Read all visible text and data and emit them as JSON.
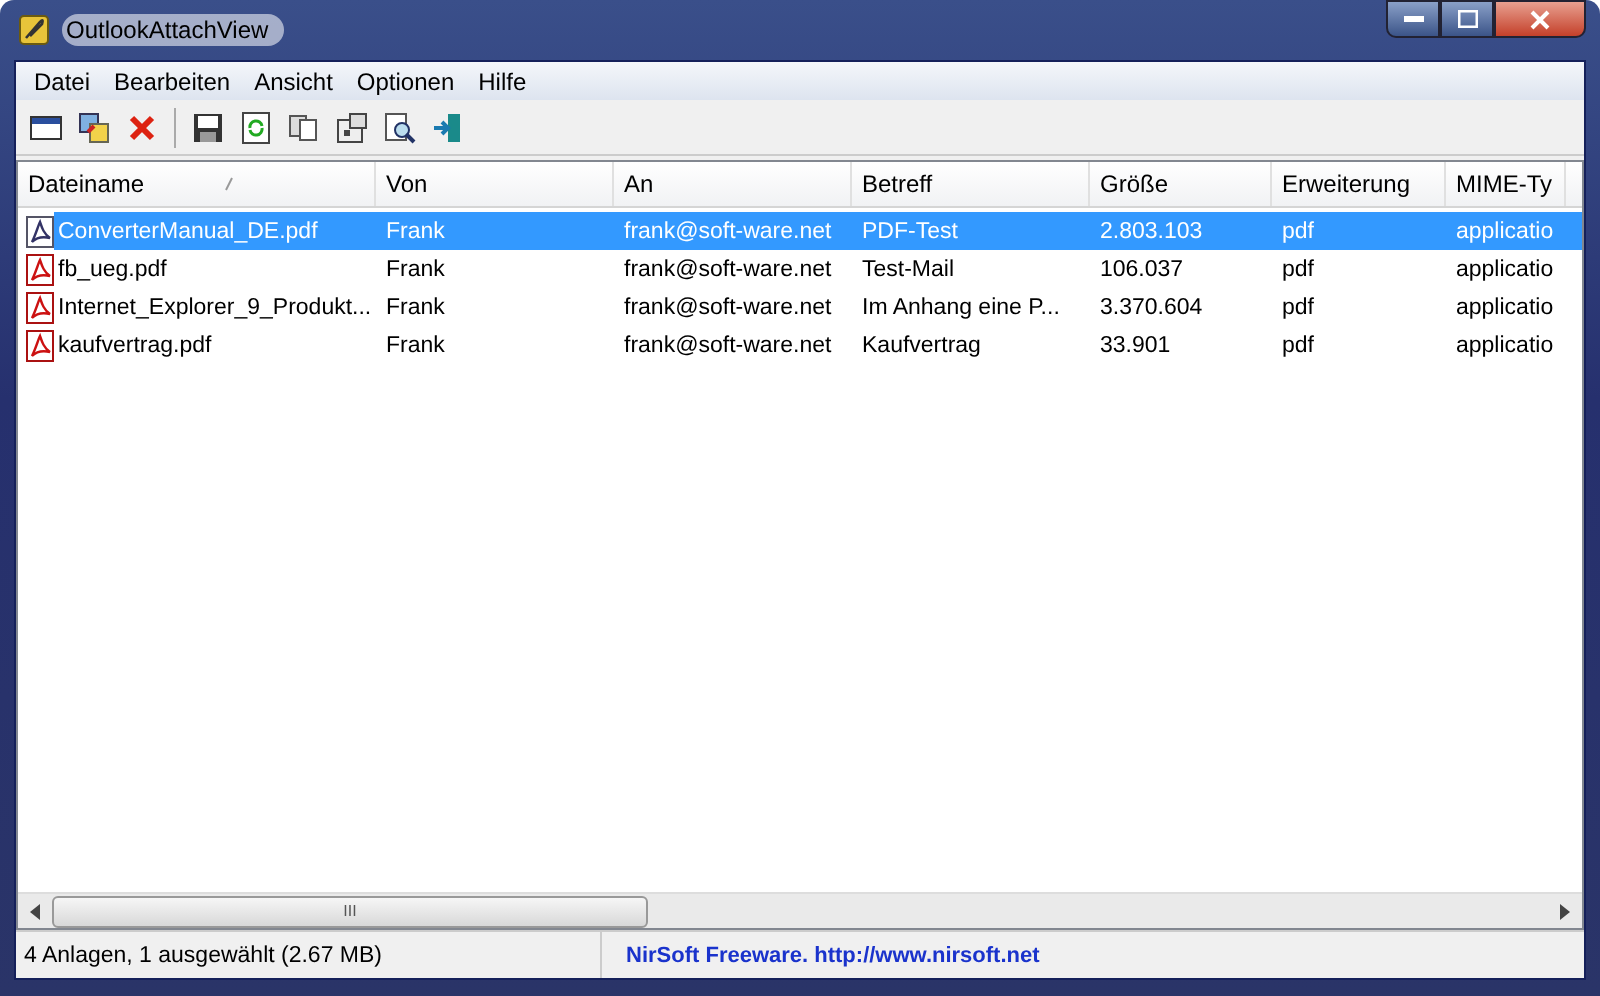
{
  "window": {
    "title": "OutlookAttachView"
  },
  "menu": [
    "Datei",
    "Bearbeiten",
    "Ansicht",
    "Optionen",
    "Hilfe"
  ],
  "toolbar": [
    {
      "kind": "properties"
    },
    {
      "kind": "copy-files"
    },
    {
      "kind": "delete"
    },
    {
      "kind": "separator"
    },
    {
      "kind": "save"
    },
    {
      "kind": "refresh"
    },
    {
      "kind": "copy"
    },
    {
      "kind": "options"
    },
    {
      "kind": "find"
    },
    {
      "kind": "exit"
    }
  ],
  "table": {
    "columns": [
      "Dateiname",
      "Von",
      "An",
      "Betreff",
      "Größe",
      "Erweiterung",
      "MIME-Ty"
    ],
    "rows": [
      {
        "selected": true,
        "cells": [
          "ConverterManual_DE.pdf",
          "Frank",
          "frank@soft-ware.net",
          "PDF-Test",
          "2.803.103",
          "pdf",
          "applicatio"
        ]
      },
      {
        "selected": false,
        "cells": [
          "fb_ueg.pdf",
          "Frank",
          "frank@soft-ware.net",
          "Test-Mail",
          "106.037",
          "pdf",
          "applicatio"
        ]
      },
      {
        "selected": false,
        "cells": [
          "Internet_Explorer_9_Produkt...",
          "Frank",
          "frank@soft-ware.net",
          "Im Anhang eine P...",
          "3.370.604",
          "pdf",
          "applicatio"
        ]
      },
      {
        "selected": false,
        "cells": [
          "kaufvertrag.pdf",
          "Frank",
          "frank@soft-ware.net",
          "Kaufvertrag",
          "33.901",
          "pdf",
          "applicatio"
        ]
      }
    ],
    "scroll_thumb": "III"
  },
  "status_bar": {
    "summary": "4 Anlagen, 1 ausgewählt  (2.67 MB)",
    "link": "NirSoft Freeware.  http://www.nirsoft.net"
  }
}
